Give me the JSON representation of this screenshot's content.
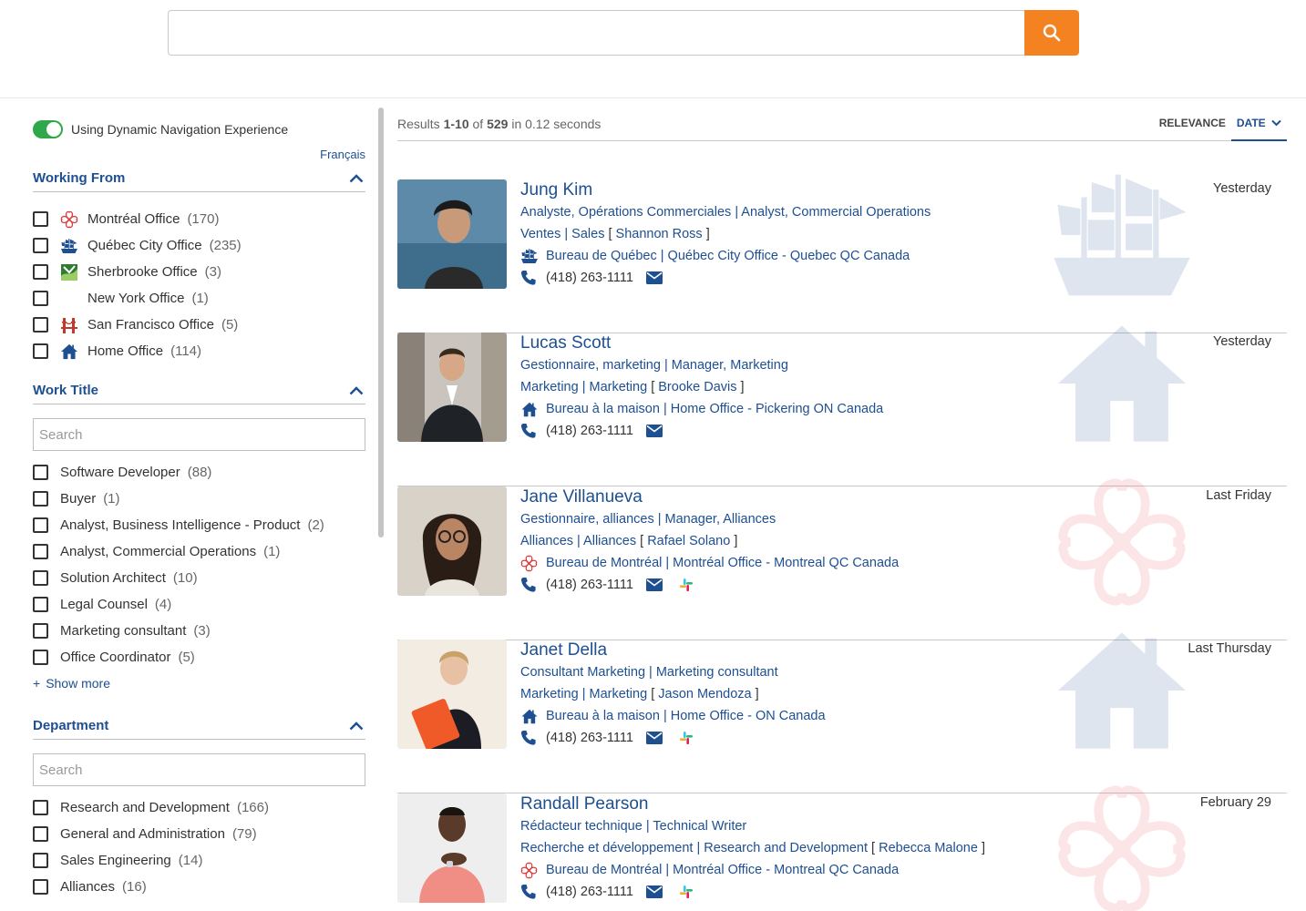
{
  "search": {
    "placeholder": "",
    "button_icon": "search-icon"
  },
  "colors": {
    "accent": "#f58220",
    "link": "#1d4f91",
    "toggle_on": "#2ea84a"
  },
  "sidebar": {
    "toggle_label": "Using Dynamic Navigation Experience",
    "toggle_on": true,
    "language_link": "Français",
    "working_from": {
      "title": "Working From",
      "items": [
        {
          "label": "Montréal Office",
          "count": "(170)",
          "icon": "montreal-flower-icon"
        },
        {
          "label": "Québec City Office",
          "count": "(235)",
          "icon": "ship-icon"
        },
        {
          "label": "Sherbrooke Office",
          "count": "(3)",
          "icon": "sherbrooke-icon"
        },
        {
          "label": "New York Office",
          "count": "(1)",
          "icon": ""
        },
        {
          "label": "San Francisco Office",
          "count": "(5)",
          "icon": "bridge-icon"
        },
        {
          "label": "Home Office",
          "count": "(114)",
          "icon": "home-icon"
        }
      ]
    },
    "work_title": {
      "title": "Work Title",
      "search_placeholder": "Search",
      "items": [
        {
          "label": "Software Developer",
          "count": "(88)"
        },
        {
          "label": "Buyer",
          "count": "(1)"
        },
        {
          "label": "Analyst, Business Intelligence - Product",
          "count": "(2)"
        },
        {
          "label": "Analyst, Commercial Operations",
          "count": "(1)"
        },
        {
          "label": "Solution Architect",
          "count": "(10)"
        },
        {
          "label": "Legal Counsel",
          "count": "(4)"
        },
        {
          "label": "Marketing consultant",
          "count": "(3)"
        },
        {
          "label": "Office Coordinator",
          "count": "(5)"
        }
      ],
      "show_more": "Show more"
    },
    "department": {
      "title": "Department",
      "search_placeholder": "Search",
      "items": [
        {
          "label": "Research and Development",
          "count": "(166)"
        },
        {
          "label": "General and Administration",
          "count": "(79)"
        },
        {
          "label": "Sales Engineering",
          "count": "(14)"
        },
        {
          "label": "Alliances",
          "count": "(16)"
        }
      ]
    }
  },
  "results": {
    "summary_prefix": "Results",
    "range": "1-10",
    "of": "of",
    "total": "529",
    "time": "in 0.12 seconds",
    "sort": {
      "relevance": "RELEVANCE",
      "date": "DATE"
    },
    "items": [
      {
        "name": "Jung Kim",
        "titles": "Analyste, Opérations Commerciales | Analyst, Commercial Operations",
        "dept": "Ventes | Sales",
        "manager": "Shannon Ross",
        "office": "Bureau de Québec | Québec City Office - Quebec QC Canada",
        "office_icon": "ship-icon",
        "phone": "(418) 263-1111",
        "date": "Yesterday",
        "slack": false,
        "watermark": "ship"
      },
      {
        "name": "Lucas Scott",
        "titles": "Gestionnaire, marketing | Manager, Marketing",
        "dept": "Marketing | Marketing",
        "manager": "Brooke Davis",
        "office": "Bureau à la maison | Home Office - Pickering ON Canada",
        "office_icon": "home-icon",
        "phone": "(418) 263-1111",
        "date": "Yesterday",
        "slack": false,
        "watermark": "home"
      },
      {
        "name": "Jane Villanueva",
        "titles": "Gestionnaire, alliances | Manager, Alliances",
        "dept": "Alliances | Alliances",
        "manager": "Rafael Solano",
        "office": "Bureau de Montréal | Montréal Office - Montreal QC Canada",
        "office_icon": "montreal-flower-icon",
        "phone": "(418) 263-1111",
        "date": "Last Friday",
        "slack": true,
        "watermark": "flower"
      },
      {
        "name": "Janet Della",
        "titles": "Consultant Marketing | Marketing consultant",
        "dept": "Marketing | Marketing",
        "manager": "Jason Mendoza",
        "office": "Bureau à la maison | Home Office - ON Canada",
        "office_icon": "home-icon",
        "phone": "(418) 263-1111",
        "date": "Last Thursday",
        "slack": true,
        "watermark": "home"
      },
      {
        "name": "Randall Pearson",
        "titles": "Rédacteur technique | Technical Writer",
        "dept": "Recherche et développement | Research and Development",
        "manager": "Rebecca Malone",
        "office": "Bureau de Montréal | Montréal Office - Montreal QC Canada",
        "office_icon": "montreal-flower-icon",
        "phone": "(418) 263-1111",
        "date": "February 29",
        "slack": true,
        "watermark": "flower"
      }
    ]
  }
}
